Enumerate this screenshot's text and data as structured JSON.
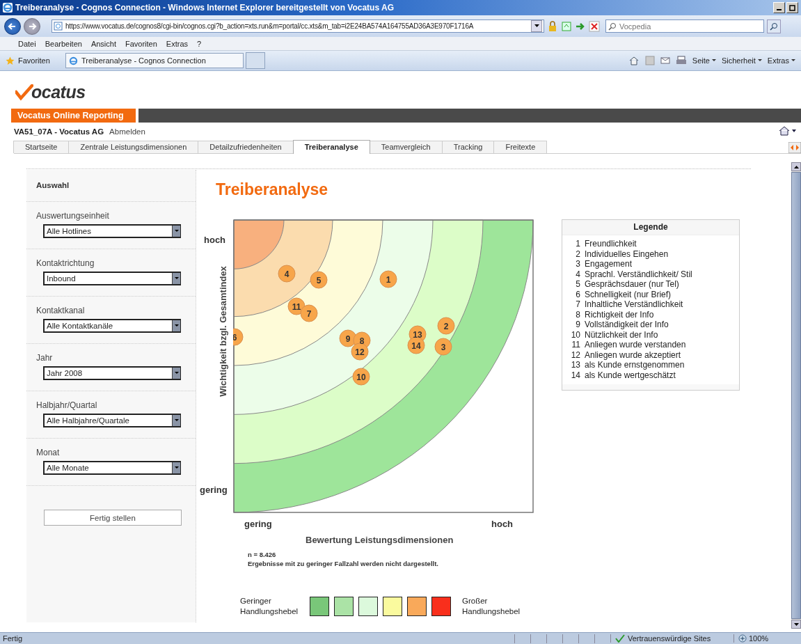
{
  "browser": {
    "title": "Treiberanalyse - Cognos Connection - Windows Internet Explorer bereitgestellt von Vocatus AG",
    "address": "https://www.vocatus.de/cognos8/cgi-bin/cognos.cgi?b_action=xts.run&m=portal/cc.xts&m_tab=i2E24BA574A164755AD36A3E970F1716A",
    "search_placeholder": "Vocpedia",
    "menu": [
      "Datei",
      "Bearbeiten",
      "Ansicht",
      "Favoriten",
      "Extras",
      "?"
    ],
    "favorites": "Favoriten",
    "tab_title": "Treiberanalyse - Cognos Connection",
    "commands": [
      "Seite",
      "Sicherheit",
      "Extras"
    ],
    "status": "Fertig",
    "zone": "Vertrauenswürdige Sites",
    "zoom": "100%"
  },
  "logo": "ocatus",
  "app_title": "Vocatus Online Reporting",
  "user": "VA51_07A - Vocatus AG",
  "logout": "Abmelden",
  "tabs": [
    {
      "label": "Startseite",
      "selected": false
    },
    {
      "label": "Zentrale Leistungsdimensionen",
      "selected": false
    },
    {
      "label": "Detailzufriedenheiten",
      "selected": false
    },
    {
      "label": "Treiberanalyse",
      "selected": true
    },
    {
      "label": "Teamvergleich",
      "selected": false
    },
    {
      "label": "Tracking",
      "selected": false
    },
    {
      "label": "Freitexte",
      "selected": false
    }
  ],
  "panel": {
    "title": "Auswahl",
    "filters": [
      {
        "label": "Auswertungseinheit",
        "value": "Alle Hotlines"
      },
      {
        "label": "Kontaktrichtung",
        "value": "Inbound"
      },
      {
        "label": "Kontaktkanal",
        "value": "Alle Kontaktkanäle"
      },
      {
        "label": "Jahr",
        "value": "Jahr 2008"
      },
      {
        "label": "Halbjahr/Quartal",
        "value": "Alle Halbjahre/Quartale"
      },
      {
        "label": "Monat",
        "value": "Alle Monate"
      }
    ],
    "submit": "Fertig stellen"
  },
  "heading": "Treiberanalyse",
  "chart": {
    "y_label": "Wichtigkeit bzgl. Gesamtindex",
    "y_high": "hoch",
    "y_low": "gering",
    "x_low": "gering",
    "x_high": "hoch",
    "x_label": "Bewertung Leistungsdimensionen",
    "points": [
      {
        "label": "6"
      },
      {
        "label": "4"
      },
      {
        "label": "5"
      },
      {
        "label": "1"
      },
      {
        "label": "11"
      },
      {
        "label": "7"
      },
      {
        "label": "9"
      },
      {
        "label": "8"
      },
      {
        "label": "12"
      },
      {
        "label": "10"
      },
      {
        "label": "13"
      },
      {
        "label": "14"
      },
      {
        "label": "2"
      },
      {
        "label": "3"
      }
    ],
    "n": "n = 8.426",
    "note": "Ergebnisse mit zu geringer Fallzahl werden nicht dargestellt."
  },
  "legend": {
    "title": "Legende",
    "items": [
      {
        "number": "1",
        "text": "Freundlichkeit"
      },
      {
        "number": "2",
        "text": "Individuelles Eingehen"
      },
      {
        "number": "3",
        "text": "Engagement"
      },
      {
        "number": "4",
        "text": "Sprachl. Verständlichkeit/ Stil"
      },
      {
        "number": "5",
        "text": "Gesprächsdauer (nur Tel)"
      },
      {
        "number": "6",
        "text": "Schnelligkeit (nur Brief)"
      },
      {
        "number": "7",
        "text": "Inhaltliche Verständlichkeit"
      },
      {
        "number": "8",
        "text": "Richtigkeit der Info"
      },
      {
        "number": "9",
        "text": "Vollständigkeit der Info"
      },
      {
        "number": "10",
        "text": "Nützlichkeit der Info"
      },
      {
        "number": "11",
        "text": "Anliegen wurde verstanden"
      },
      {
        "number": "12",
        "text": "Anliegen wurde akzeptiert"
      },
      {
        "number": "13",
        "text": "als Kunde ernstgenommen"
      },
      {
        "number": "14",
        "text": "als Kunde wertgeschätzt"
      }
    ]
  },
  "scale": {
    "low_label": "Geringer Handlungshebel",
    "high_label": "Großer Handlungshebel",
    "swatches": [
      {
        "color": "#79c779"
      },
      {
        "color": "#abe3a6"
      },
      {
        "color": "#dcf9dc"
      },
      {
        "color": "#fafa9e"
      },
      {
        "color": "#f9a95a"
      },
      {
        "color": "#f92f1c"
      }
    ]
  }
}
